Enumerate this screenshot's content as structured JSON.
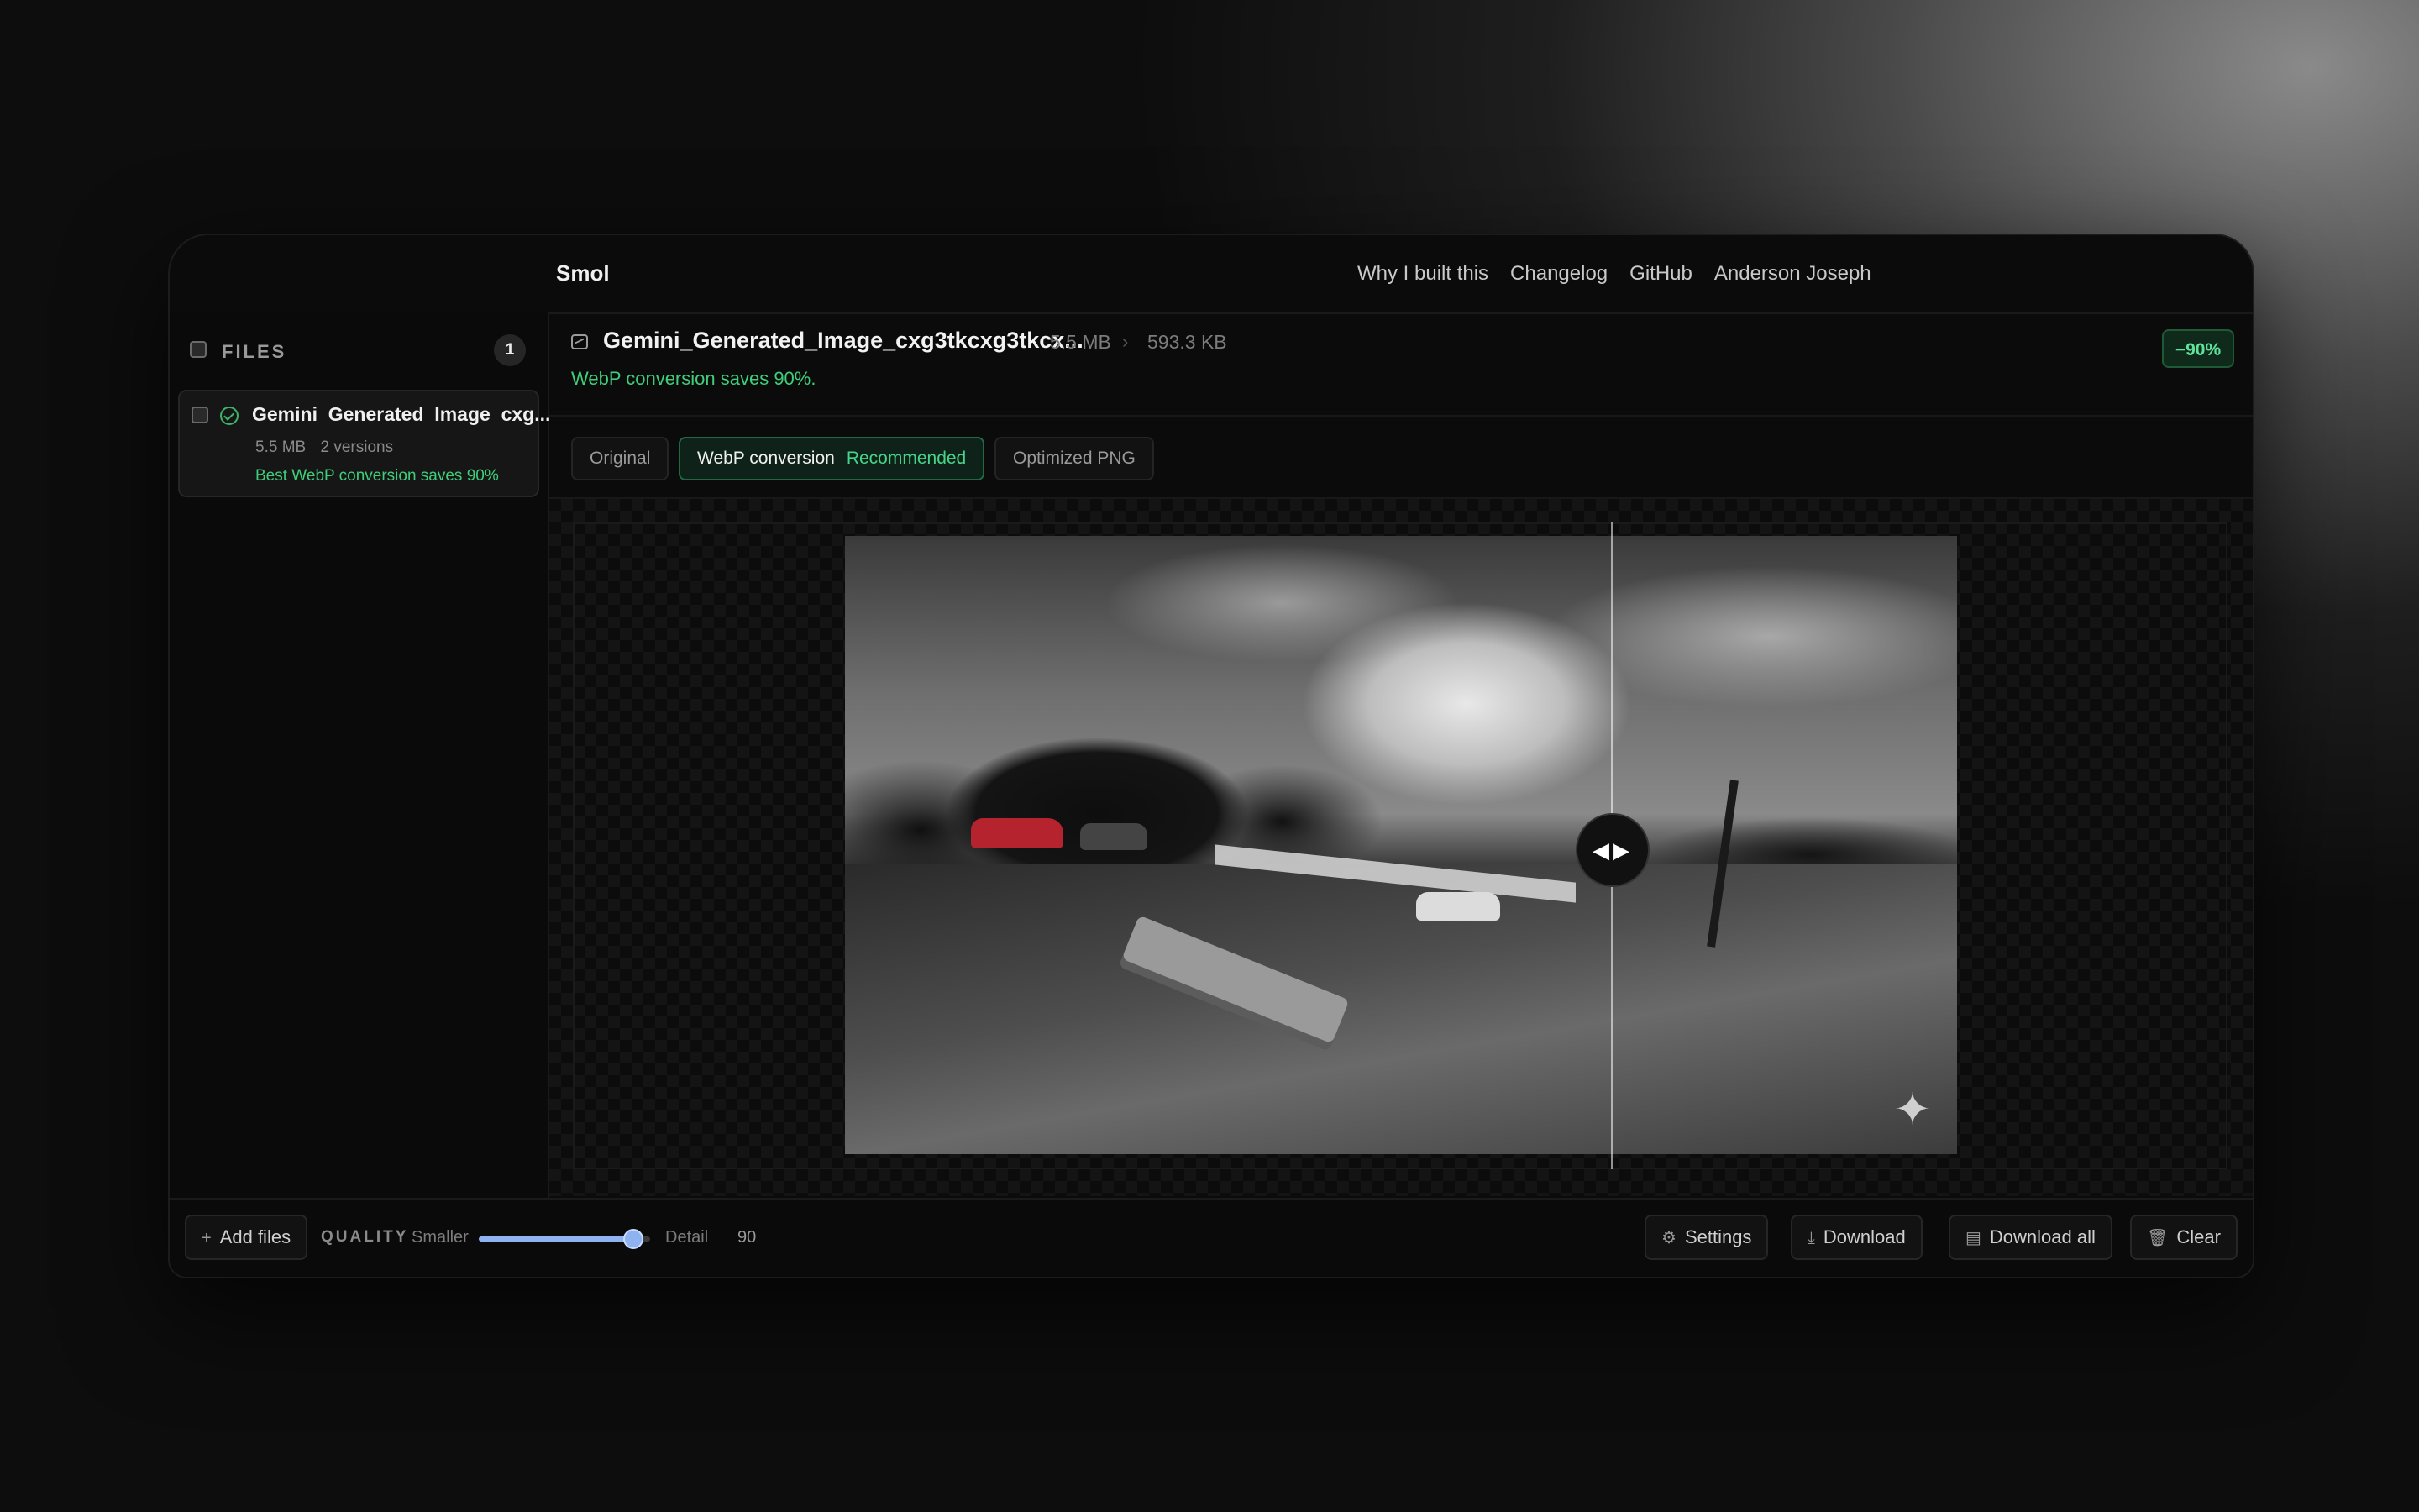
{
  "app": {
    "name": "Smol"
  },
  "nav": [
    "Why I built this",
    "Changelog",
    "GitHub",
    "Anderson Joseph"
  ],
  "sidebar": {
    "files_label": "FILES",
    "files_count": "1",
    "file": {
      "name": "Gemini_Generated_Image_cxg...",
      "size": "5.5 MB",
      "versions": "2 versions",
      "best": "Best WebP conversion saves 90%"
    }
  },
  "main": {
    "title": "Gemini_Generated_Image_cxg3tkcxg3tkcx...",
    "original_size": "5.5 MB",
    "arrow": "›",
    "new_size": "593.3 KB",
    "saves_text": "WebP conversion saves 90%.",
    "badge": "−90%",
    "tabs": [
      {
        "label": "Original"
      },
      {
        "label": "WebP conversion",
        "tag": "Recommended"
      },
      {
        "label": "Optimized PNG"
      }
    ]
  },
  "compare": {
    "split_fraction": 0.535,
    "handle_icon": "◀▶",
    "sparkle_icon": "✦"
  },
  "bottom": {
    "add_files": "Add files",
    "add_icon": "+",
    "quality_label": "QUALITY",
    "smaller_label": "Smaller",
    "detail_label": "Detail",
    "quality_value": "90",
    "quality_fraction": 0.9,
    "settings": "Settings",
    "download": "Download",
    "download_all": "Download all",
    "clear": "Clear",
    "icons": {
      "settings": "gear-icon",
      "download": "download-icon",
      "download_all": "archive-icon",
      "clear": "trash-icon"
    }
  },
  "colors": {
    "accent_green": "#3ecf7a",
    "slider_blue": "#8fb3f0"
  }
}
